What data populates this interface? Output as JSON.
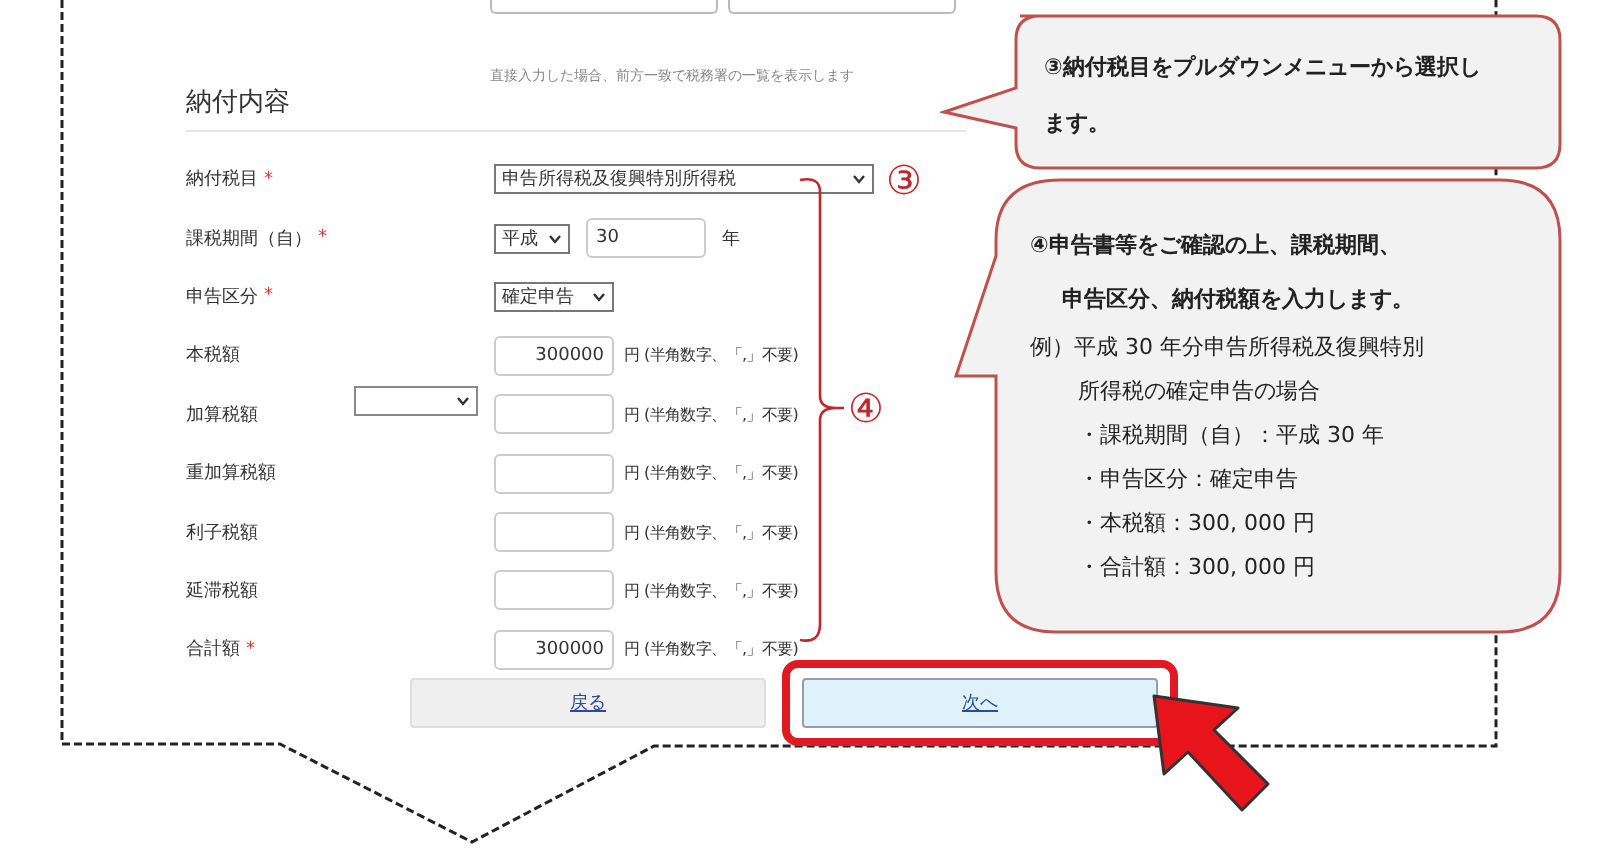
{
  "top_fields": [
    {
      "kind": "field"
    },
    {
      "kind": "field"
    }
  ],
  "top_note": "直接入力した場合、前方一致で税務署の一覧を表示します",
  "section_title": "納付内容",
  "rows": [
    {
      "kind": "select",
      "label": "納付税目",
      "required_mark": "*",
      "value": "申告所得税及復興特別所得税",
      "step_mark": "③"
    },
    {
      "kind": "era",
      "label": "課税期間（自）",
      "required_mark": "*",
      "era": "平成",
      "year": "30",
      "unit": "年"
    },
    {
      "kind": "short_select",
      "label": "申告区分",
      "required_mark": "*",
      "value": "確定申告"
    },
    {
      "kind": "amount",
      "label": "本税額",
      "value": "300000",
      "unit": "円 (半角数字、「,」不要)"
    },
    {
      "kind": "amount_with_select",
      "label": "加算税額",
      "unit": "円 (半角数字、「,」不要)"
    },
    {
      "kind": "amount",
      "label": "重加算税額",
      "unit": "円 (半角数字、「,」不要)"
    },
    {
      "kind": "amount",
      "label": "利子税額",
      "unit": "円 (半角数字、「,」不要)"
    },
    {
      "kind": "amount",
      "label": "延滞税額",
      "unit": "円 (半角数字、「,」不要)"
    },
    {
      "kind": "amount",
      "label": "合計額",
      "required_mark": "*",
      "value": "300000",
      "unit": "円 (半角数字、「,」不要)"
    }
  ],
  "bracket_mark": "④",
  "buttons": [
    {
      "label": "戻る",
      "highlighted": false
    },
    {
      "label": "次へ",
      "highlighted": true
    }
  ],
  "callouts": [
    {
      "lines": [
        {
          "kind": "lead",
          "text": "③納付税目をプルダウンメニューから選択し"
        },
        {
          "kind": "lead",
          "text": "ます。"
        }
      ]
    },
    {
      "lines": [
        {
          "kind": "lead",
          "text": "④申告書等をご確認の上、課税期間、"
        },
        {
          "kind": "lead_cont",
          "text": "申告区分、納付税額を入力します。"
        },
        {
          "kind": "example",
          "text": "例）平成 30 年分申告所得税及復興特別"
        },
        {
          "kind": "example_cont",
          "text": "所得税の確定申告の場合"
        },
        {
          "kind": "bullet",
          "text": "・課税期間（自）：平成 30 年"
        },
        {
          "kind": "bullet",
          "text": "・申告区分：確定申告"
        },
        {
          "kind": "bullet",
          "text": "・本税額：300, 000 円"
        },
        {
          "kind": "bullet",
          "text": "・合計額：300, 000 円"
        }
      ]
    }
  ]
}
